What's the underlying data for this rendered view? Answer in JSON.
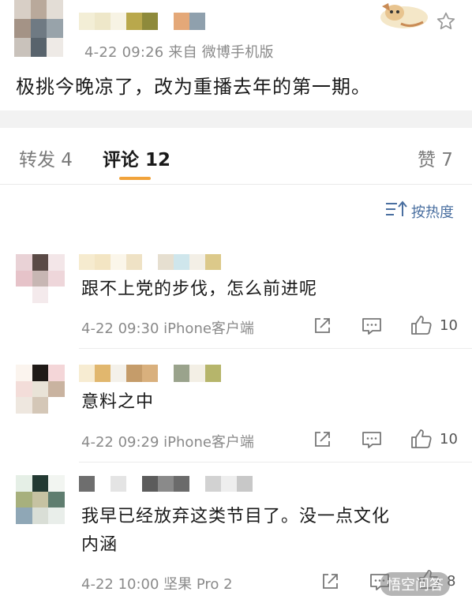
{
  "post": {
    "meta": "4-22 09:26  来自 微博手机版",
    "text": "极挑今晚凉了，改为重播去年的第一期。"
  },
  "tabs": [
    {
      "label": "转发 4"
    },
    {
      "label": "评论 12"
    },
    {
      "label": "赞 7"
    }
  ],
  "sort": {
    "label": "按热度"
  },
  "comments": [
    {
      "text": "跟不上党的步伐，怎么前进呢",
      "meta": "4-22 09:30 iPhone客户端",
      "likes": "10"
    },
    {
      "text": "意料之中",
      "meta": "4-22 09:29 iPhone客户端",
      "likes": "10"
    },
    {
      "text_line1": "我早已经放弃这类节目了。没一点文化",
      "text_line2": "内涵",
      "meta": "4-22 10:00 坚果 Pro 2",
      "likes": "8"
    }
  ],
  "watermark": "悟空问答",
  "colors": {
    "accent_orange": "#f1a33b",
    "link_blue": "#4a6fa0",
    "meta_gray": "#8a8a8a"
  },
  "icons": [
    "star-icon",
    "sort-icon",
    "share-icon",
    "reply-icon",
    "like-icon",
    "cartoon-dog-sticker"
  ]
}
